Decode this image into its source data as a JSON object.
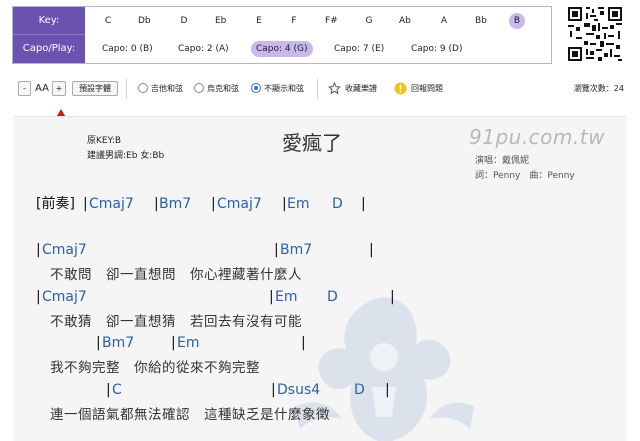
{
  "key_panel": {
    "key_label": "Key:",
    "keys": [
      "C",
      "Db",
      "D",
      "Eb",
      "E",
      "F",
      "F#",
      "G",
      "Ab",
      "A",
      "Bb",
      "B"
    ],
    "selected_key": "B",
    "capo_label": "Capo/Play:",
    "capos": [
      "Capo: 0 (B)",
      "Capo: 2 (A)",
      "Capo: 4 (G)",
      "Capo: 7 (E)",
      "Capo: 9 (D)"
    ],
    "selected_capo": "Capo: 4 (G)",
    "accent_color": "#6a52b0",
    "selected_color": "#c9b8ec"
  },
  "toolbar": {
    "minus": "-",
    "aa": "AA",
    "plus": "+",
    "preset": "預設字體",
    "options": [
      "吉他和弦",
      "烏克和弦",
      "不顯示和弦"
    ],
    "selected_option": "不顯示和弦",
    "favorite": "收藏樂譜",
    "report": "回報問題",
    "views": "瀏覽次數：24"
  },
  "song": {
    "original_key": "原KEY:B",
    "suggested_key": "建議男調:Eb 女:Bb",
    "title": "愛瘋了",
    "site": "91pu.com.tw",
    "singer": "演唱：戴佩妮",
    "writers": "詞：Penny　曲：Penny"
  },
  "sheet": {
    "intro": {
      "label": "[前奏]",
      "chords": [
        "Cmaj7",
        "Bm7",
        "Cmaj7",
        "Em",
        "D"
      ]
    },
    "lines": [
      {
        "chords": [
          "Cmaj7",
          "Bm7"
        ],
        "lyric": "不敢問　卻一直想問　你心裡藏著什麼人"
      },
      {
        "chords": [
          "Cmaj7",
          "Em",
          "D"
        ],
        "lyric": "不敢猜　卻一直想猜　若回去有沒有可能"
      },
      {
        "chords": [
          "Bm7",
          "Em"
        ],
        "lyric": "我不夠完整　你給的從來不夠完整"
      },
      {
        "chords": [
          "C",
          "Dsus4",
          "D"
        ],
        "lyric": "連一個語氣都無法確認　這種缺乏是什麼象徵"
      }
    ]
  }
}
